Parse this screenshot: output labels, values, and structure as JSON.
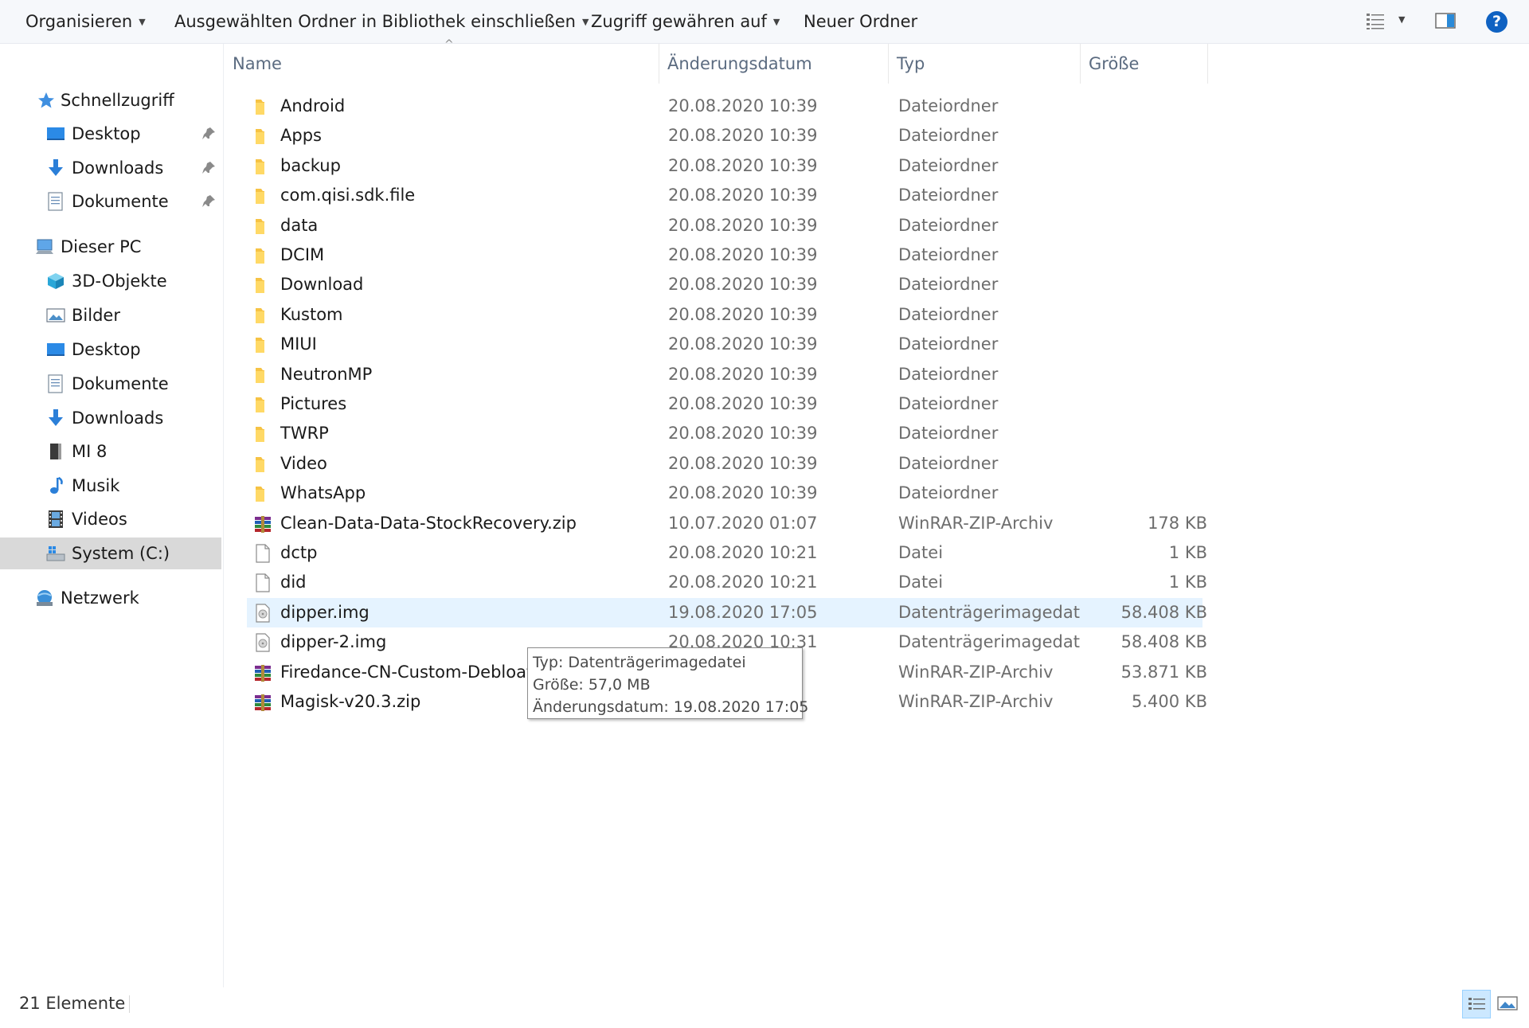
{
  "toolbar": {
    "organize": "Organisieren",
    "include_library": "Ausgewählten Ordner in Bibliothek einschließen",
    "share_with": "Zugriff gewähren auf",
    "new_folder": "Neuer Ordner",
    "help": "?"
  },
  "nav": {
    "quick_access": "Schnellzugriff",
    "quick_items": [
      "Desktop",
      "Downloads",
      "Dokumente"
    ],
    "this_pc": "Dieser PC",
    "pc_items": [
      "3D-Objekte",
      "Bilder",
      "Desktop",
      "Dokumente",
      "Downloads",
      "MI 8",
      "Musik",
      "Videos",
      "System (C:)"
    ],
    "network": "Netzwerk"
  },
  "columns": {
    "name": "Name",
    "date": "Änderungsdatum",
    "type": "Typ",
    "size": "Größe"
  },
  "files": [
    {
      "name": "Android",
      "date": "20.08.2020 10:39",
      "type": "Dateiordner",
      "size": "",
      "icon": "folder"
    },
    {
      "name": "Apps",
      "date": "20.08.2020 10:39",
      "type": "Dateiordner",
      "size": "",
      "icon": "folder"
    },
    {
      "name": "backup",
      "date": "20.08.2020 10:39",
      "type": "Dateiordner",
      "size": "",
      "icon": "folder"
    },
    {
      "name": "com.qisi.sdk.file",
      "date": "20.08.2020 10:39",
      "type": "Dateiordner",
      "size": "",
      "icon": "folder"
    },
    {
      "name": "data",
      "date": "20.08.2020 10:39",
      "type": "Dateiordner",
      "size": "",
      "icon": "folder"
    },
    {
      "name": "DCIM",
      "date": "20.08.2020 10:39",
      "type": "Dateiordner",
      "size": "",
      "icon": "folder"
    },
    {
      "name": "Download",
      "date": "20.08.2020 10:39",
      "type": "Dateiordner",
      "size": "",
      "icon": "folder"
    },
    {
      "name": "Kustom",
      "date": "20.08.2020 10:39",
      "type": "Dateiordner",
      "size": "",
      "icon": "folder"
    },
    {
      "name": "MIUI",
      "date": "20.08.2020 10:39",
      "type": "Dateiordner",
      "size": "",
      "icon": "folder"
    },
    {
      "name": "NeutronMP",
      "date": "20.08.2020 10:39",
      "type": "Dateiordner",
      "size": "",
      "icon": "folder"
    },
    {
      "name": "Pictures",
      "date": "20.08.2020 10:39",
      "type": "Dateiordner",
      "size": "",
      "icon": "folder"
    },
    {
      "name": "TWRP",
      "date": "20.08.2020 10:39",
      "type": "Dateiordner",
      "size": "",
      "icon": "folder"
    },
    {
      "name": "Video",
      "date": "20.08.2020 10:39",
      "type": "Dateiordner",
      "size": "",
      "icon": "folder"
    },
    {
      "name": "WhatsApp",
      "date": "20.08.2020 10:39",
      "type": "Dateiordner",
      "size": "",
      "icon": "folder"
    },
    {
      "name": "Clean-Data-Data-StockRecovery.zip",
      "date": "10.07.2020 01:07",
      "type": "WinRAR-ZIP-Archiv",
      "size": "178 KB",
      "icon": "winrar"
    },
    {
      "name": "dctp",
      "date": "20.08.2020 10:21",
      "type": "Datei",
      "size": "1 KB",
      "icon": "file"
    },
    {
      "name": "did",
      "date": "20.08.2020 10:21",
      "type": "Datei",
      "size": "1 KB",
      "icon": "file"
    },
    {
      "name": "dipper.img",
      "date": "19.08.2020 17:05",
      "type": "Datenträgerimagedat...",
      "size": "58.408 KB",
      "icon": "disk-image"
    },
    {
      "name": "dipper-2.img",
      "date": "20.08.2020 10:31",
      "type": "Datenträgerimagedat...",
      "size": "58.408 KB",
      "icon": "disk-image"
    },
    {
      "name": "Firedance-CN-Custom-Debloat-N",
      "date": "",
      "type": "WinRAR-ZIP-Archiv",
      "size": "53.871 KB",
      "icon": "winrar"
    },
    {
      "name": "Magisk-v20.3.zip",
      "date": "",
      "type": "WinRAR-ZIP-Archiv",
      "size": "5.400 KB",
      "icon": "winrar"
    }
  ],
  "tooltip": {
    "type_line": "Typ: Datenträgerimagedatei",
    "size_line": "Größe: 57,0 MB",
    "date_line": "Änderungsdatum: 19.08.2020 17:05"
  },
  "status": {
    "count": "21 Elemente"
  },
  "colors": {
    "accent": "#0f62c2",
    "selected_nav": "#d9d9d9",
    "hover_row": "#e5f3ff",
    "folder": "#f6c344"
  }
}
